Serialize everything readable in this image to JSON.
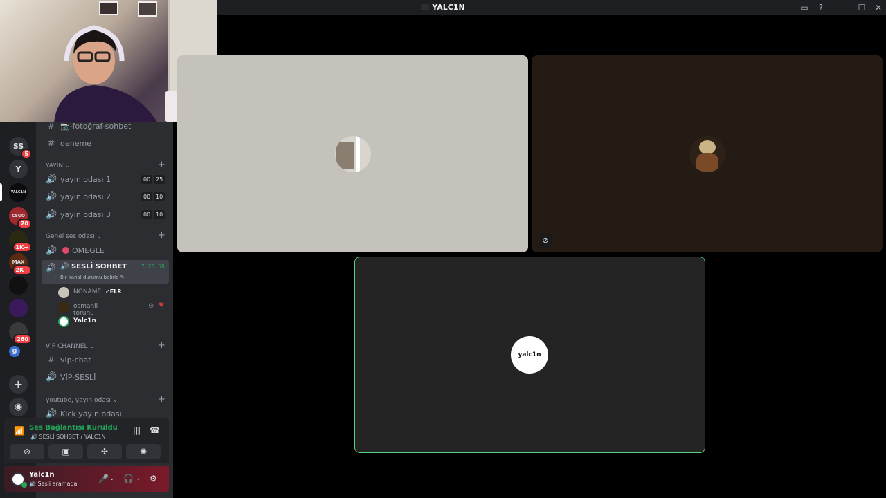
{
  "window": {
    "title": "YALC1N",
    "controls": [
      "_",
      "☐",
      "✕"
    ]
  },
  "guilds": [
    {
      "label": "SS",
      "badge": "5"
    },
    {
      "label": "Y",
      "badge": ""
    },
    {
      "label": "YALC1N",
      "badge": ""
    },
    {
      "label": "CSGO SKIN",
      "badge": "20"
    },
    {
      "label": "",
      "badge": "1K+"
    },
    {
      "label": "MAX",
      "badge": "2K+"
    },
    {
      "label": "",
      "badge": ""
    },
    {
      "label": "",
      "badge": ""
    },
    {
      "label": "",
      "badge": "260"
    },
    {
      "label": "g",
      "badge": ""
    }
  ],
  "channels": {
    "top": [
      {
        "icon": "#",
        "name": "📷-fotoğraf-sohbet"
      },
      {
        "icon": "#",
        "name": "deneme"
      }
    ],
    "cat_yayin": "YAYIN",
    "yayin": [
      {
        "name": "yayın odası 1",
        "c1": "00",
        "c2": "25"
      },
      {
        "name": "yayın odası 2",
        "c1": "00",
        "c2": "10"
      },
      {
        "name": "yayın odası 3",
        "c1": "00",
        "c2": "10"
      }
    ],
    "cat_genel": "Genel ses odası",
    "omegle": "OMEGLE",
    "active": {
      "name": "SESLİ SOHBET",
      "time": "7:20:58",
      "status": "Bir kanal durumu belirle"
    },
    "members": [
      {
        "name": "NONAME",
        "tag": "ELR"
      },
      {
        "name": "osmanli torunu"
      },
      {
        "name": "Yalc1n"
      }
    ],
    "cat_vip": "VİP CHANNEL",
    "vip": [
      {
        "icon": "#",
        "name": "vip-chat"
      },
      {
        "icon": "🔊",
        "name": "VİP-SESLİ"
      }
    ],
    "cat_youtube": "youtube, yayın odası",
    "kick": "Kick yayın odası"
  },
  "voice": {
    "status": "Ses Bağlantısı Kuruldu",
    "location": "SESLİ SOHBET / YALC1N"
  },
  "user": {
    "name": "Yalc1n",
    "status": "Sesli aramada"
  },
  "tiles": {
    "self_label": "yalc1n"
  }
}
